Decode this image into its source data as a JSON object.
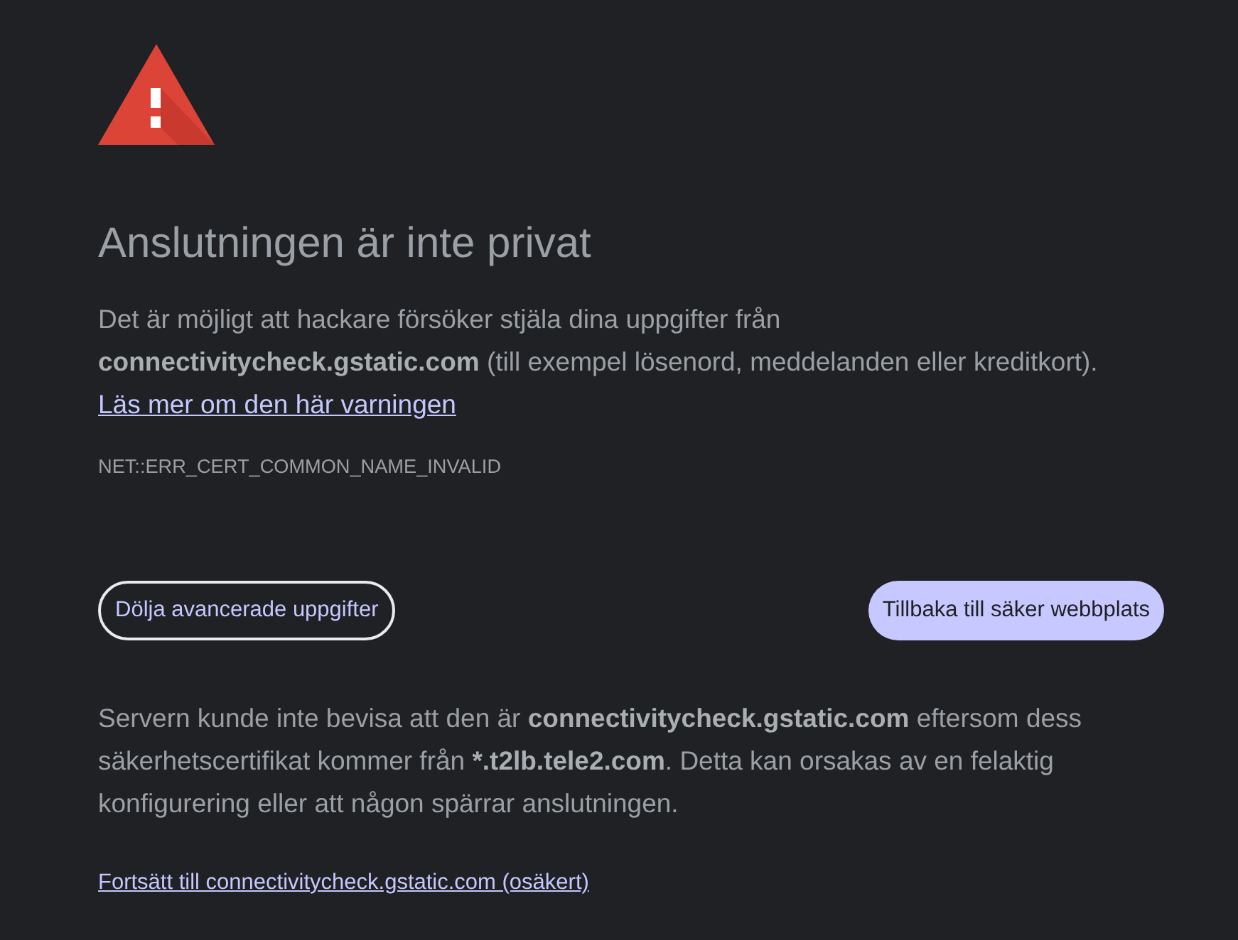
{
  "heading": "Anslutningen är inte privat",
  "intro": {
    "text": "Det är möjligt att hackare försöker stjäla dina uppgifter från **connectivitycheck.gstatic.com** (till exempel lösenord, meddelanden eller kreditkort).",
    "link": "Läs mer om den här varningen"
  },
  "error_code": "NET::ERR_CERT_COMMON_NAME_INVALID",
  "buttons": [
    {
      "label": "Dölja avancerade uppgifter",
      "kind": "outlined"
    },
    {
      "label": "Tillbaka till säker webbplats",
      "kind": "filled"
    }
  ],
  "details": [
    {
      "text": "Servern kunde inte bevisa att den är ",
      "bold": false
    },
    {
      "text": "connectivitycheck.gstatic.com",
      "bold": true
    },
    {
      "text": " eftersom dess säkerhetscertifikat kommer från ",
      "bold": false
    },
    {
      "text": "*.t2lb.tele2.com",
      "bold": true
    },
    {
      "text": ". Detta kan orsakas av en felaktig konfigurering eller att någon spärrar anslutningen.",
      "bold": false
    }
  ],
  "proceed_link": "Fortsätt till connectivitycheck.gstatic.com (osäkert)"
}
